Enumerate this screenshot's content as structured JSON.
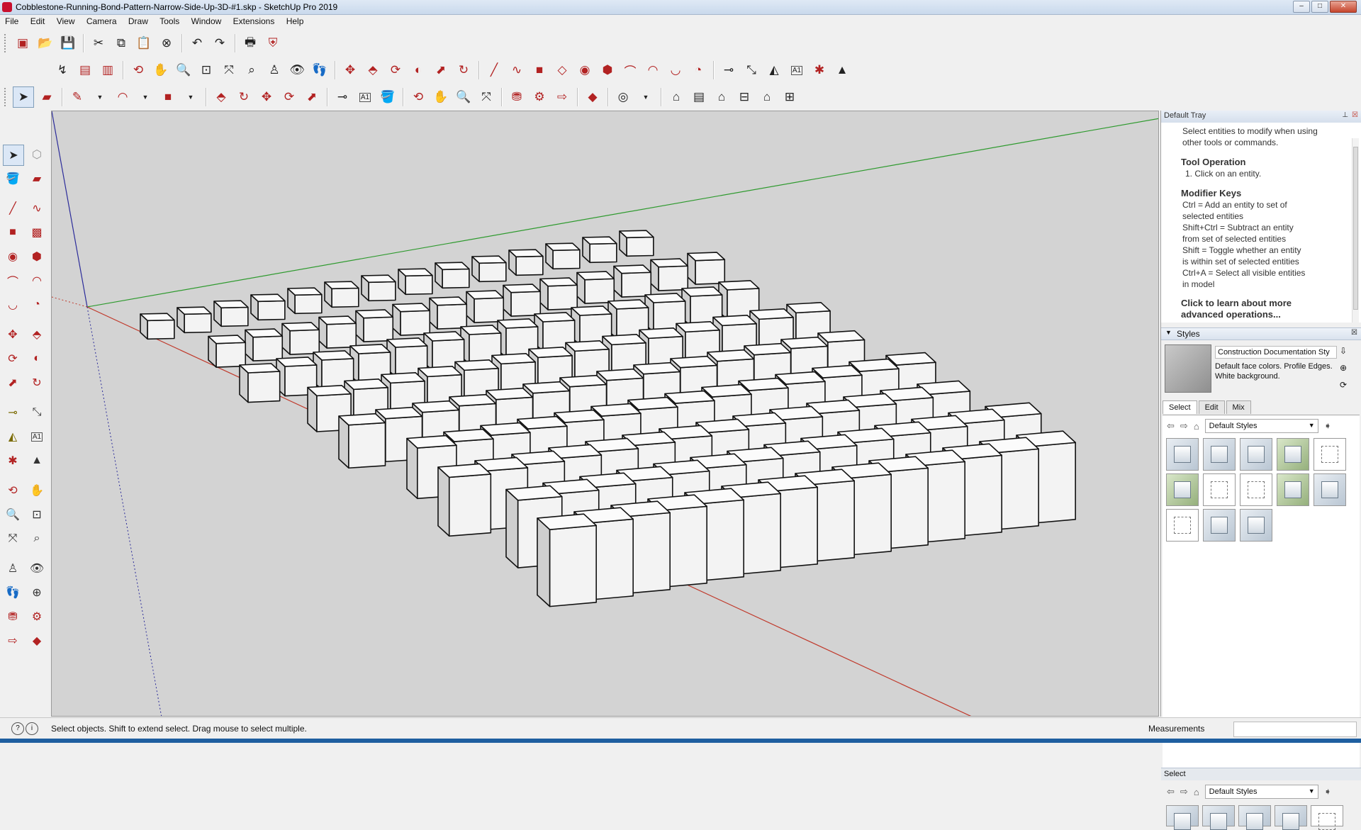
{
  "window": {
    "title": "Cobblestone-Running-Bond-Pattern-Narrow-Side-Up-3D-#1.skp - SketchUp Pro 2019",
    "controls": [
      "–",
      "□",
      "✕"
    ]
  },
  "menu": [
    "File",
    "Edit",
    "View",
    "Camera",
    "Draw",
    "Tools",
    "Window",
    "Extensions",
    "Help"
  ],
  "toolbar_text_tool": "A1",
  "tray": {
    "header": "Default Tray",
    "instructor": {
      "intro": "Select entities to modify when using other tools or commands.",
      "tool_operation_heading": "Tool Operation",
      "tool_operation_step": "1. Click on an entity.",
      "modifier_keys_heading": "Modifier Keys",
      "modifier_lines": [
        "Ctrl = Add an entity to set of",
        "selected entities",
        "Shift+Ctrl = Subtract an entity",
        "from set of selected entities",
        "Shift = Toggle whether an entity",
        "is within set of selected entities",
        "Ctrl+A = Select all visible entities",
        "in model"
      ],
      "learn_more": "Click to learn about more advanced operations..."
    },
    "styles": {
      "heading": "Styles",
      "style_name": "Construction Documentation Sty",
      "description": "Default face colors. Profile Edges. White background.",
      "tabs": [
        "Select",
        "Edit",
        "Mix"
      ],
      "collection": "Default Styles",
      "second_section": "Select",
      "second_collection": "Default Styles"
    }
  },
  "statusbar": {
    "message": "Select objects. Shift to extend select. Drag mouse to select multiple.",
    "measurements_label": "Measurements"
  },
  "colors": {
    "viewport_bg": "#d3d3d3",
    "red_axis": "#c0392b",
    "green_axis": "#2e9a2e",
    "blue_axis": "#2c2c9a"
  }
}
